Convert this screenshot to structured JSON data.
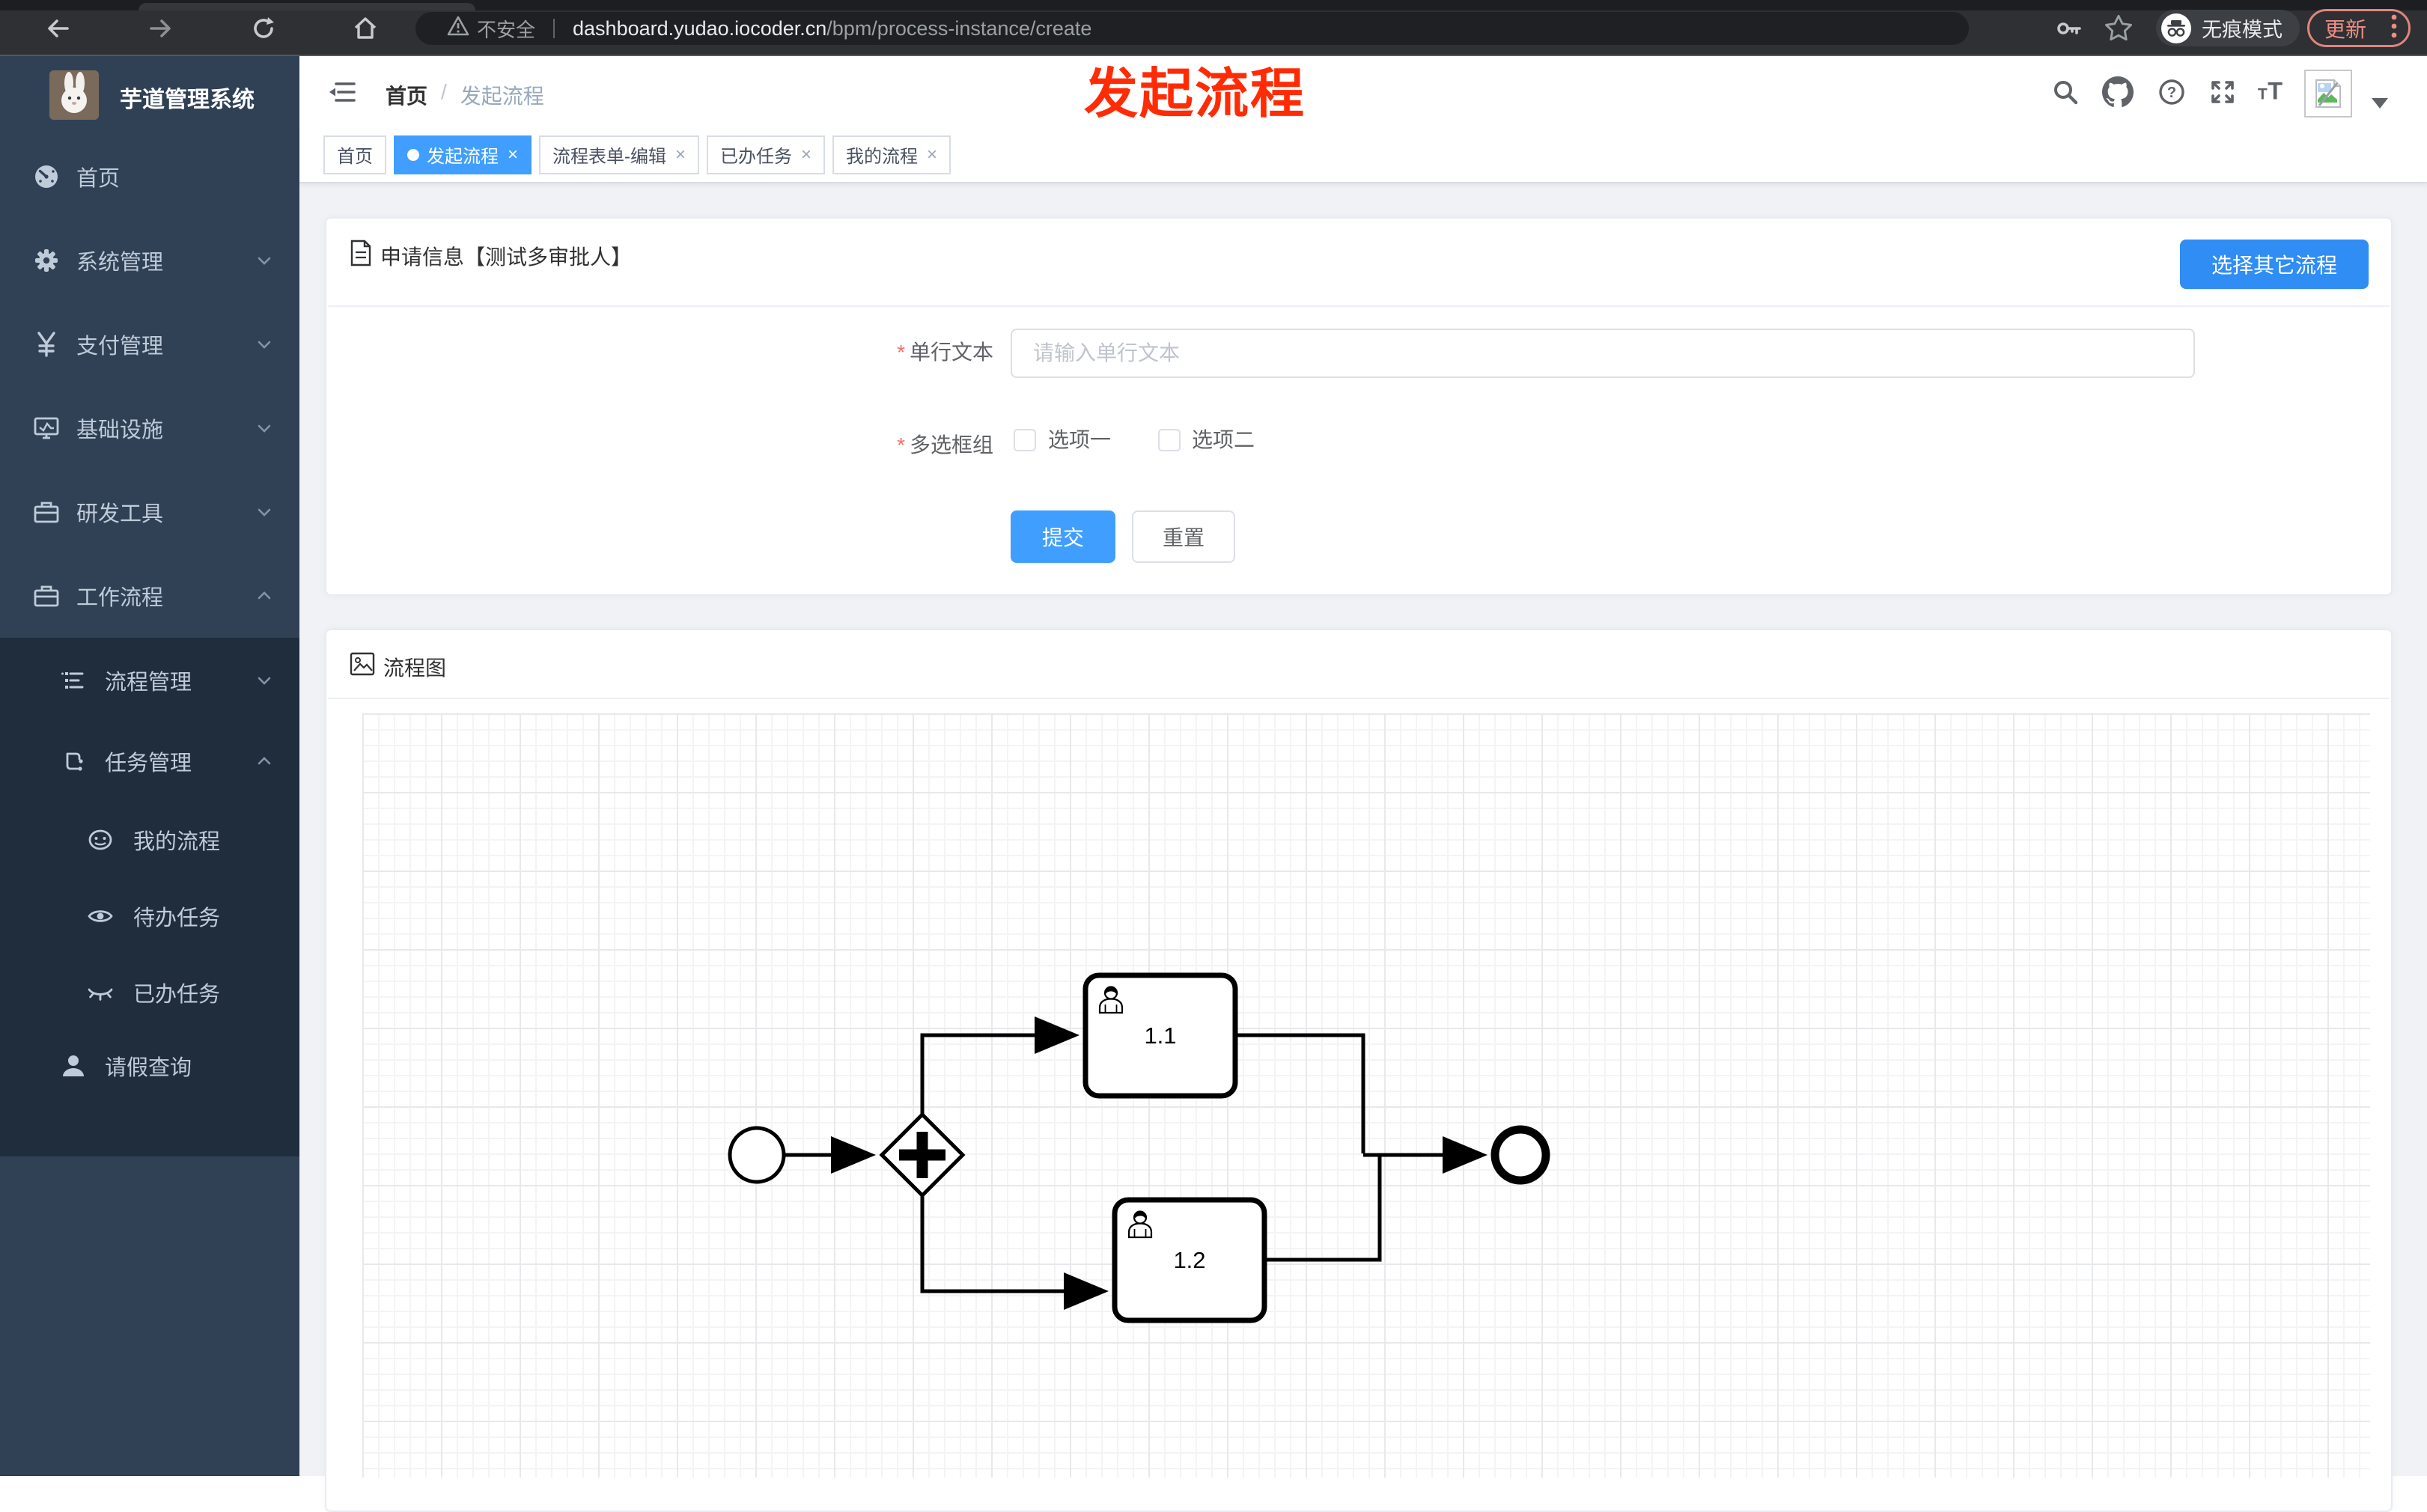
{
  "colors": {
    "accent_blue": "#409EFF",
    "button_blue": "#2F8DF4",
    "sidebar_bg": "#304156",
    "sidebar_submenu_bg": "#1F2D3D",
    "sidebar_text": "#BFCBD9",
    "annotation_red": "#FF2B05",
    "page_bg": "#F0F2F5",
    "update_pill": "#EE8D83"
  },
  "browser": {
    "security_label": "不安全",
    "url_domain": "dashboard.yudao.iocoder.cn",
    "url_path": "/bpm/process-instance/create",
    "incognito_label": "无痕模式",
    "update_label": "更新"
  },
  "annotation": {
    "text": "发起流程"
  },
  "sidebar": {
    "title": "芋道管理系统",
    "items": [
      {
        "label": "首页"
      },
      {
        "label": "系统管理"
      },
      {
        "label": "支付管理"
      },
      {
        "label": "基础设施"
      },
      {
        "label": "研发工具"
      },
      {
        "label": "工作流程"
      },
      {
        "label": "流程管理"
      },
      {
        "label": "任务管理"
      },
      {
        "label": "我的流程"
      },
      {
        "label": "待办任务"
      },
      {
        "label": "已办任务"
      },
      {
        "label": "请假查询"
      }
    ]
  },
  "header": {
    "breadcrumb_home": "首页",
    "breadcrumb_separator": "/",
    "breadcrumb_current": "发起流程"
  },
  "tabs": [
    {
      "label": "首页"
    },
    {
      "label": "发起流程"
    },
    {
      "label": "流程表单-编辑"
    },
    {
      "label": "已办任务"
    },
    {
      "label": "我的流程"
    }
  ],
  "tab_close_glyph": "×",
  "form_card": {
    "title": "申请信息【测试多审批人】",
    "action_button": "选择其它流程",
    "field1": {
      "required_mark": "*",
      "label": "单行文本",
      "placeholder": "请输入单行文本",
      "value": ""
    },
    "field2": {
      "required_mark": "*",
      "label": "多选框组",
      "option1": "选项一",
      "option2": "选项二",
      "option1_checked": false,
      "option2_checked": false
    },
    "submit_label": "提交",
    "reset_label": "重置"
  },
  "diagram_card": {
    "title": "流程图",
    "task1_label": "1.1",
    "task2_label": "1.2"
  }
}
